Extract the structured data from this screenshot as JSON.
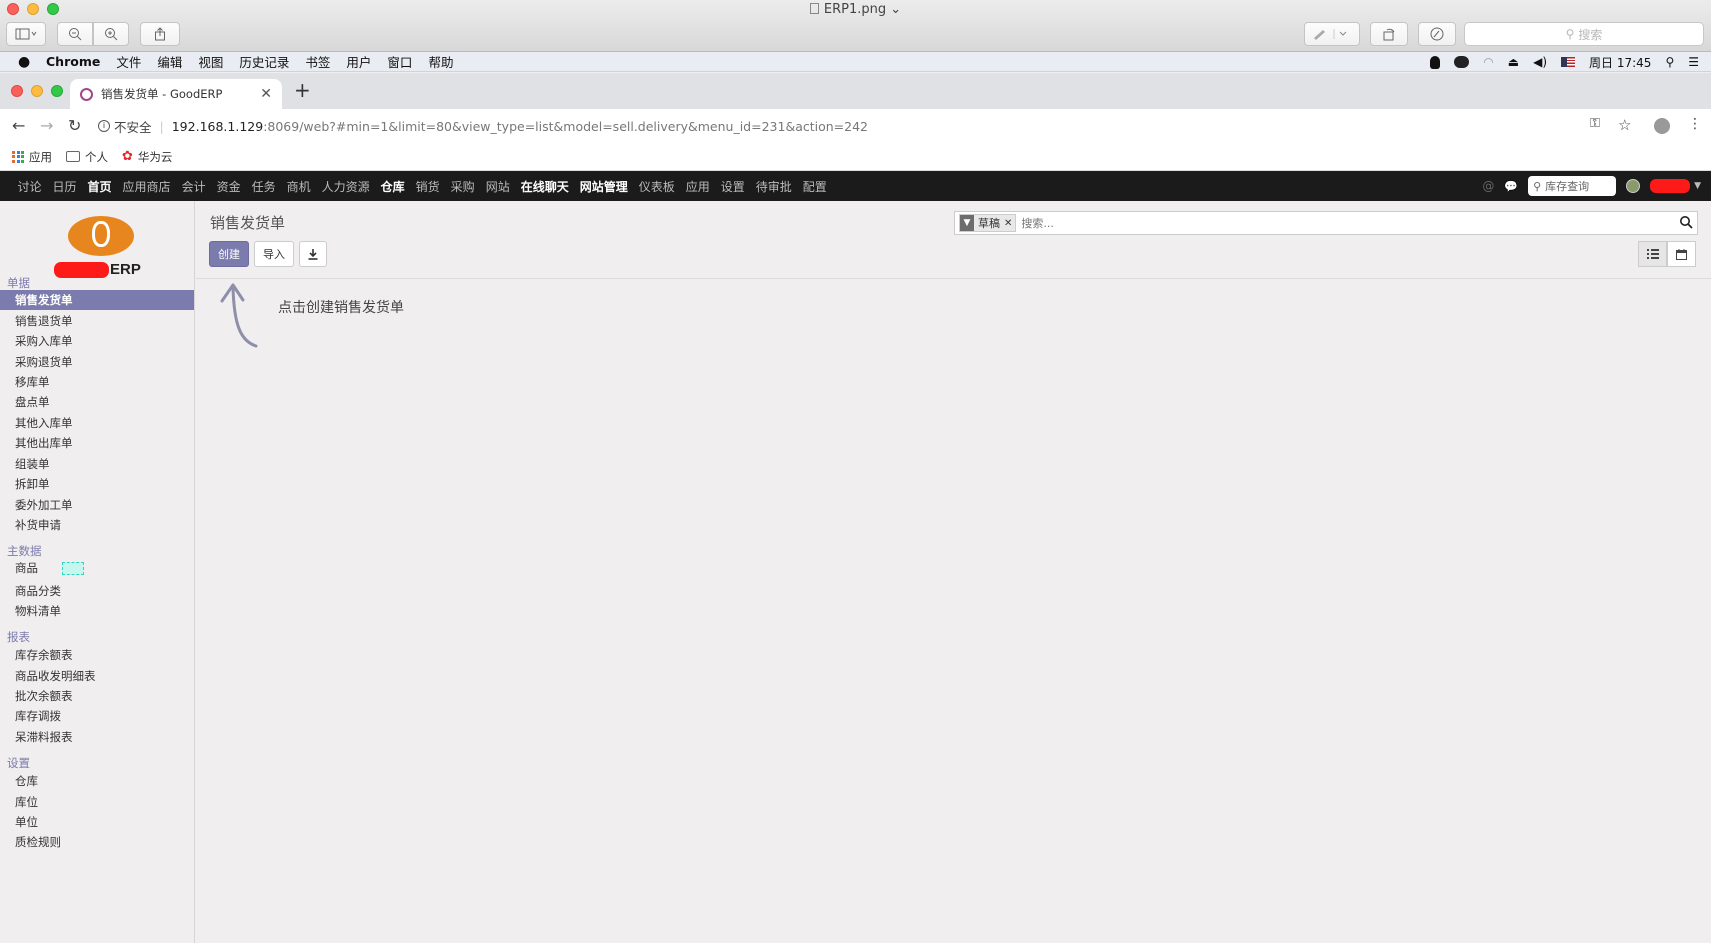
{
  "preview": {
    "title": "ERP1.png",
    "search_placeholder": "搜索"
  },
  "mac_menu": {
    "app": "Chrome",
    "items": [
      "文件",
      "编辑",
      "视图",
      "历史记录",
      "书签",
      "用户",
      "窗口",
      "帮助"
    ],
    "clock": "周日 17:45"
  },
  "browser": {
    "tab_title": "销售发货单 - GoodERP",
    "insecure_label": "不安全",
    "url_host": "192.168.1.129",
    "url_path": ":8069/web?#min=1&limit=80&view_type=list&model=sell.delivery&menu_id=231&action=242",
    "bookmarks": [
      "应用",
      "个人",
      "华为云"
    ]
  },
  "topnav": {
    "items": [
      {
        "label": "讨论",
        "bold": false
      },
      {
        "label": "日历",
        "bold": false
      },
      {
        "label": "首页",
        "bold": true
      },
      {
        "label": "应用商店",
        "bold": false
      },
      {
        "label": "会计",
        "bold": false
      },
      {
        "label": "资金",
        "bold": false
      },
      {
        "label": "任务",
        "bold": false
      },
      {
        "label": "商机",
        "bold": false
      },
      {
        "label": "人力资源",
        "bold": false
      },
      {
        "label": "仓库",
        "bold": true
      },
      {
        "label": "销货",
        "bold": false
      },
      {
        "label": "采购",
        "bold": false
      },
      {
        "label": "网站",
        "bold": false
      },
      {
        "label": "在线聊天",
        "bold": true
      },
      {
        "label": "网站管理",
        "bold": true
      },
      {
        "label": "仪表板",
        "bold": false
      },
      {
        "label": "应用",
        "bold": false
      },
      {
        "label": "设置",
        "bold": false
      },
      {
        "label": "待审批",
        "bold": false
      },
      {
        "label": "配置",
        "bold": false
      }
    ],
    "stock_search": "库存查询"
  },
  "logo": {
    "text": "ERP"
  },
  "sidebar": {
    "sections": [
      {
        "title": "单据",
        "items": [
          "销售发货单",
          "销售退货单",
          "采购入库单",
          "采购退货单",
          "移库单",
          "盘点单",
          "其他入库单",
          "其他出库单",
          "组装单",
          "拆卸单",
          "委外加工单",
          "补货申请"
        ]
      },
      {
        "title": "主数据",
        "items": [
          "商品",
          "商品分类",
          "物料清单"
        ]
      },
      {
        "title": "报表",
        "items": [
          "库存余额表",
          "商品收发明细表",
          "批次余额表",
          "库存调拨",
          "呆滞料报表"
        ]
      },
      {
        "title": "设置",
        "items": [
          "仓库",
          "库位",
          "单位",
          "质检规则"
        ]
      }
    ],
    "active": "销售发货单"
  },
  "main": {
    "breadcrumb": "销售发货单",
    "create_label": "创建",
    "import_label": "导入",
    "filter_facet": "草稿",
    "search_placeholder": "搜索...",
    "help_text": "点击创建销售发货单"
  },
  "colors": {
    "accent": "#7c7bad",
    "topnav_bg": "#1b1b1b",
    "logo_orange": "#e7861e"
  }
}
